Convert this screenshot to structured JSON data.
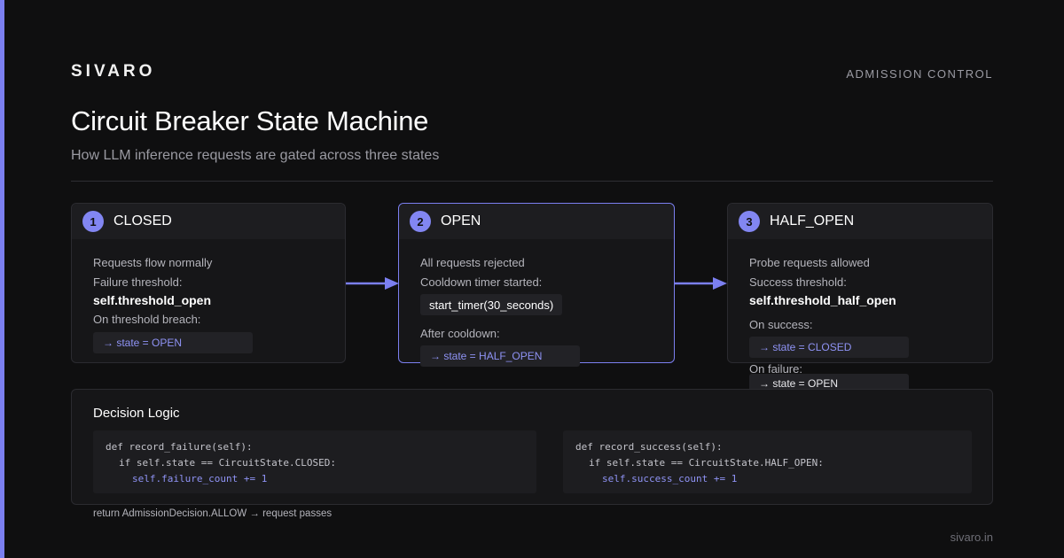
{
  "brand": "SIVARO",
  "section_tag": "ADMISSION CONTROL",
  "title": "Circuit Breaker State Machine",
  "subtitle": "How LLM inference requests are gated across three states",
  "colors": {
    "accent": "#7b7ff0",
    "background": "#0f0f10",
    "card": "#161618"
  },
  "states": [
    {
      "number": "1",
      "name": "CLOSED",
      "description": "Requests flow normally",
      "threshold_label": "Failure threshold:",
      "threshold_value": "self.threshold_open",
      "trigger_label": "On threshold breach:",
      "transition": "→ state = OPEN"
    },
    {
      "number": "2",
      "name": "OPEN",
      "description": "All requests rejected",
      "timer_label": "Cooldown timer started:",
      "timer_call": "start_timer(30_seconds)",
      "after_label": "After cooldown:",
      "transition": "→ state = HALF_OPEN"
    },
    {
      "number": "3",
      "name": "HALF_OPEN",
      "description": "Probe requests allowed",
      "threshold_label": "Success threshold:",
      "threshold_value": "self.threshold_half_open",
      "success_label": "On success:",
      "success_transition": "→ state = CLOSED",
      "failure_label": "On failure:",
      "failure_transition": "→ state = OPEN"
    }
  ],
  "decision_logic": {
    "title": "Decision Logic",
    "code_blocks": [
      {
        "line1": "def record_failure(self):",
        "line2": "if self.state == CircuitState.CLOSED:",
        "line3": "self.failure_count += 1"
      },
      {
        "line1": "def record_success(self):",
        "line2": "if self.state == CircuitState.HALF_OPEN:",
        "line3": "self.success_count += 1"
      }
    ]
  },
  "footnote": "return AdmissionDecision.ALLOW → request passes",
  "site": "sivaro.in"
}
